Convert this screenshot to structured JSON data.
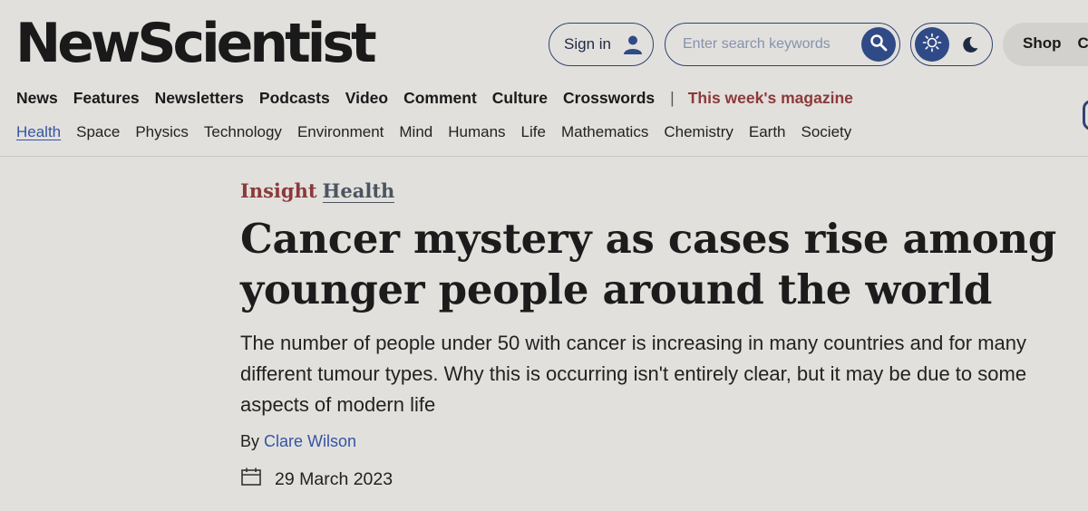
{
  "logo": {
    "text": "NewScientist"
  },
  "header": {
    "sign_in_label": "Sign in",
    "search_placeholder": "Enter search keywords",
    "shop_label": "Shop",
    "shop_label_cutoff": "Co"
  },
  "main_nav": {
    "items": [
      {
        "label": "News"
      },
      {
        "label": "Features"
      },
      {
        "label": "Newsletters"
      },
      {
        "label": "Podcasts"
      },
      {
        "label": "Video"
      },
      {
        "label": "Comment"
      },
      {
        "label": "Culture"
      },
      {
        "label": "Crosswords"
      }
    ],
    "separator": "|",
    "magazine_label": "This week's magazine"
  },
  "sub_nav": {
    "items": [
      {
        "label": "Health",
        "active": true
      },
      {
        "label": "Space"
      },
      {
        "label": "Physics"
      },
      {
        "label": "Technology"
      },
      {
        "label": "Environment"
      },
      {
        "label": "Mind"
      },
      {
        "label": "Humans"
      },
      {
        "label": "Life"
      },
      {
        "label": "Mathematics"
      },
      {
        "label": "Chemistry"
      },
      {
        "label": "Earth"
      },
      {
        "label": "Society"
      }
    ]
  },
  "article": {
    "kicker_type": "Insight",
    "kicker_section": "Health",
    "headline": "Cancer mystery as cases rise among younger people around the world",
    "standfirst": "The number of people under 50 with cancer is increasing in many countries and for many different tumour types. Why this is occurring isn't entirely clear, but it may be due to some aspects of modern life",
    "byline_prefix": "By",
    "author": "Clare Wilson",
    "date": "29 March 2023"
  },
  "icons": {
    "user": "user-icon",
    "search": "search-icon",
    "sun": "sun-icon",
    "moon": "moon-icon",
    "calendar": "calendar-icon"
  },
  "colors": {
    "background": "#e2e0dd",
    "accent_blue": "#2f4a86",
    "kicker_red": "#8a3a3a",
    "link_blue": "#3455a4"
  }
}
